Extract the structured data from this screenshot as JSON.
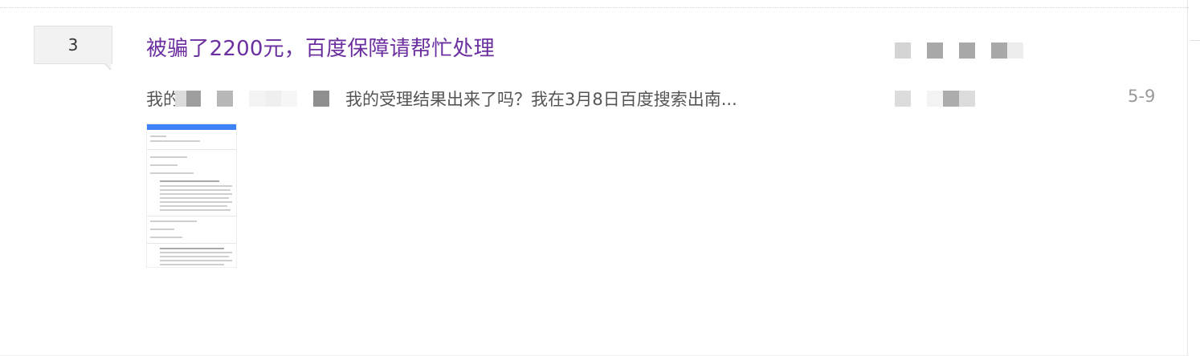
{
  "thread": {
    "reply_count": "3",
    "title": "被骗了2200元，百度保障请帮忙处理",
    "abstract_prefix": "我的",
    "abstract_text": "我的受理结果出来了吗？我在3月8日百度搜索出南...",
    "last_reply_time": "5-9"
  },
  "colors": {
    "title": "#6b2fa0",
    "badge_bg": "#f2f2f2",
    "thumb_header": "#3e82f7"
  },
  "icons": {
    "thumbnail": "document-screenshot-thumbnail"
  }
}
